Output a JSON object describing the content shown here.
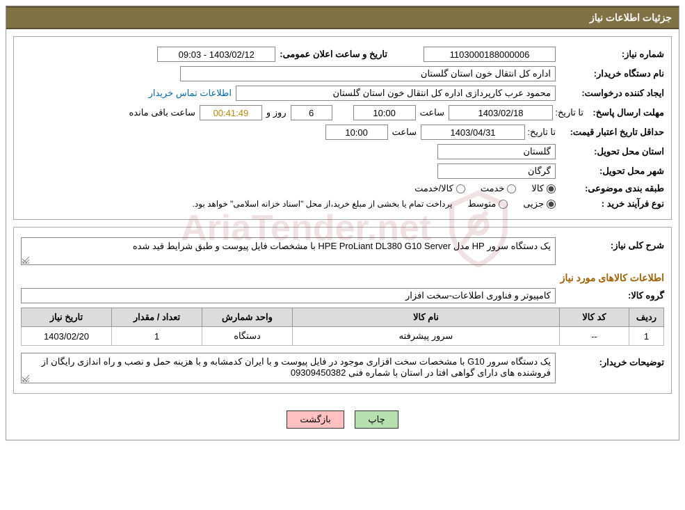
{
  "header": {
    "title": "جزئیات اطلاعات نیاز"
  },
  "fields": {
    "need_no_label": "شماره نیاز:",
    "need_no": "1103000188000006",
    "ann_date_label": "تاریخ و ساعت اعلان عمومی:",
    "ann_date": "1403/02/12 - 09:03",
    "buyer_label": "نام دستگاه خریدار:",
    "buyer": "اداره کل انتقال خون استان گلستان",
    "requester_label": "ایجاد کننده درخواست:",
    "requester": "محمود عرب کارپردازی اداره کل انتقال خون استان گلستان",
    "contact_link": "اطلاعات تماس خریدار",
    "reply_deadline_label": "مهلت ارسال پاسخ:",
    "until_date_label": "تا تاریخ:",
    "reply_date": "1403/02/18",
    "time_label": "ساعت",
    "reply_time": "10:00",
    "days_and": "روز و",
    "days_remaining": "6",
    "countdown": "00:41:49",
    "remaining_label": "ساعت باقی مانده",
    "min_valid_label": "حداقل تاریخ اعتبار قیمت:",
    "min_valid_date": "1403/04/31",
    "min_valid_time": "10:00",
    "province_label": "استان محل تحویل:",
    "province": "گلستان",
    "city_label": "شهر محل تحویل:",
    "city": "گرگان",
    "category_label": "طبقه بندی موضوعی:",
    "cat_goods": "کالا",
    "cat_service": "خدمت",
    "cat_goods_service": "کالا/خدمت",
    "proc_type_label": "نوع فرآیند خرید :",
    "proc_partial": "جزیی",
    "proc_medium": "متوسط",
    "proc_note": "پرداخت تمام یا بخشی از مبلغ خرید،از محل \"اسناد خزانه اسلامی\" خواهد بود.",
    "overall_desc_label": "شرح کلی نیاز:",
    "overall_desc": "یک دستگاه سرور HP مدل HPE ProLiant DL380 G10 Server با مشخصات فایل پیوست و طبق شرایط قید شده",
    "goods_info_h": "اطلاعات کالاهای مورد نیاز",
    "group_label": "گروه کالا:",
    "group": "کامپیوتر و فناوری اطلاعات-سخت افزار",
    "buyer_notes_label": "توضیحات خریدار:",
    "buyer_notes": "یک دستگاه سرور G10 با مشخصات سخت افزاری موجود در فایل پیوست و با ایران کدمشابه و با هزینه حمل و نصب و راه اندازی رایگان از فروشنده های دارای گواهی افتا در استان با شماره فنی 09309450382"
  },
  "table": {
    "headers": {
      "row": "ردیف",
      "code": "کد کالا",
      "name": "نام کالا",
      "unit": "واحد شمارش",
      "qty": "تعداد / مقدار",
      "date": "تاریخ نیاز"
    },
    "rows": [
      {
        "row": "1",
        "code": "--",
        "name": "سرور پیشرفته",
        "unit": "دستگاه",
        "qty": "1",
        "date": "1403/02/20"
      }
    ]
  },
  "buttons": {
    "print": "چاپ",
    "back": "بازگشت"
  },
  "watermark": "AriaTender.net"
}
